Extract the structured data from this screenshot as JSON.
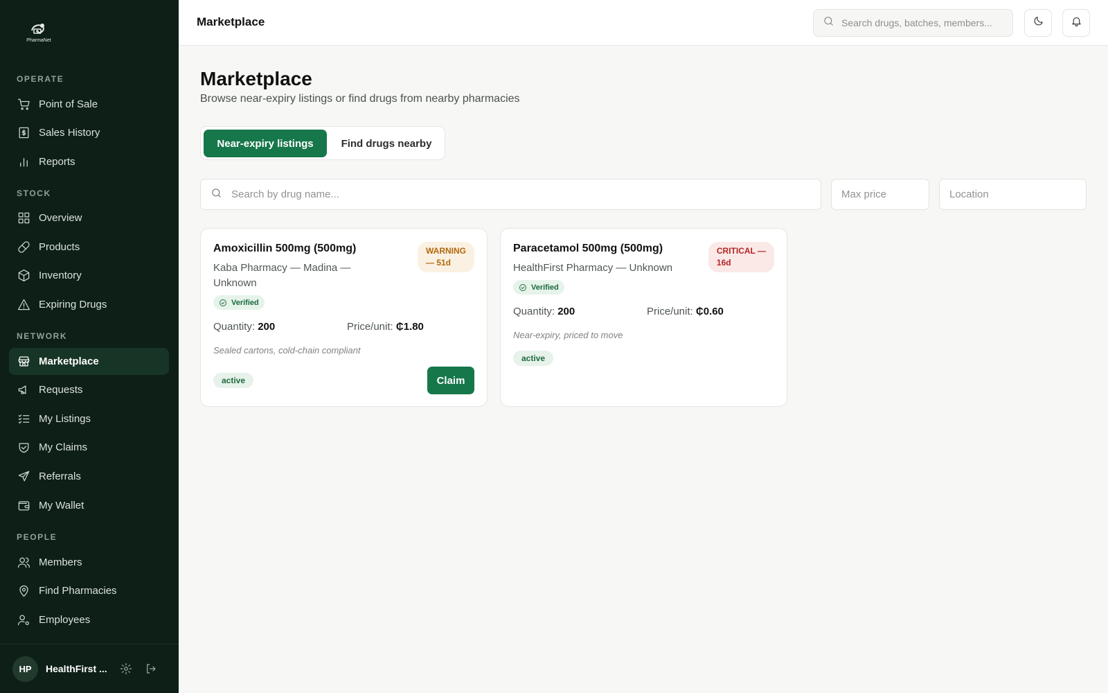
{
  "app": {
    "logo_text": "PharmaNet"
  },
  "sidebar": {
    "sections": [
      {
        "label": "OPERATE",
        "items": [
          {
            "label": "Point of Sale",
            "icon": "cart-icon"
          },
          {
            "label": "Sales History",
            "icon": "receipt-icon"
          },
          {
            "label": "Reports",
            "icon": "bar-chart-icon"
          }
        ]
      },
      {
        "label": "STOCK",
        "items": [
          {
            "label": "Overview",
            "icon": "grid-icon"
          },
          {
            "label": "Products",
            "icon": "pill-icon"
          },
          {
            "label": "Inventory",
            "icon": "box-icon"
          },
          {
            "label": "Expiring Drugs",
            "icon": "warning-triangle-icon"
          }
        ]
      },
      {
        "label": "NETWORK",
        "items": [
          {
            "label": "Marketplace",
            "icon": "store-icon",
            "active": true
          },
          {
            "label": "Requests",
            "icon": "megaphone-icon"
          },
          {
            "label": "My Listings",
            "icon": "checklist-icon"
          },
          {
            "label": "My Claims",
            "icon": "handshake-icon"
          },
          {
            "label": "Referrals",
            "icon": "send-icon"
          },
          {
            "label": "My Wallet",
            "icon": "wallet-icon"
          }
        ]
      },
      {
        "label": "PEOPLE",
        "items": [
          {
            "label": "Members",
            "icon": "users-icon"
          },
          {
            "label": "Find Pharmacies",
            "icon": "map-pin-icon"
          },
          {
            "label": "Employees",
            "icon": "user-cog-icon"
          }
        ]
      }
    ],
    "user": {
      "initials": "HP",
      "name": "HealthFirst ..."
    }
  },
  "topbar": {
    "title": "Marketplace",
    "search_placeholder": "Search drugs, batches, members..."
  },
  "main": {
    "title": "Marketplace",
    "subtitle": "Browse near-expiry listings or find drugs from nearby pharmacies",
    "tabs": [
      {
        "label": "Near-expiry listings",
        "active": true
      },
      {
        "label": "Find drugs nearby",
        "active": false
      }
    ],
    "filters": {
      "search_placeholder": "Search by drug name...",
      "max_price_placeholder": "Max price",
      "location_placeholder": "Location"
    },
    "listings": [
      {
        "title": "Amoxicillin 500mg (500mg)",
        "pharmacy_line1": "Kaba Pharmacy — Madina —",
        "pharmacy_line2": "Unknown",
        "badge_line1": "WARNING",
        "badge_line2": "— 51d",
        "badge_color": "#b2670c",
        "verified": "Verified",
        "quantity_label": "Quantity:",
        "quantity": "200",
        "price_label": "Price/unit:",
        "price": "₵1.80",
        "note": "Sealed cartons, cold-chain compliant",
        "status": "active",
        "action": "Claim"
      },
      {
        "title": "Paracetamol 500mg (500mg)",
        "pharmacy_line1": "HealthFirst Pharmacy — Unknown",
        "badge_line1": "CRITICAL —",
        "badge_line2": "16d",
        "badge_color": "#b42424",
        "verified": "Verified",
        "quantity_label": "Quantity:",
        "quantity": "200",
        "price_label": "Price/unit:",
        "price": "₵0.60",
        "note": "Near-expiry, priced to move",
        "status": "active"
      }
    ]
  },
  "colors": {
    "primary": "#16774a",
    "sidebar_bg": "#0d1f17",
    "warning": "#b2670c",
    "critical": "#b42424"
  }
}
